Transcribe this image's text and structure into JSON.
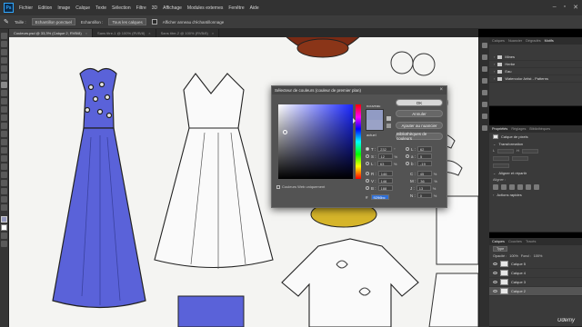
{
  "menubar": {
    "logo": "Ps",
    "items": [
      "Fichier",
      "Edition",
      "Image",
      "Calque",
      "Texte",
      "Sélection",
      "Filtre",
      "3D",
      "Affichage",
      "Modules externes",
      "Fenêtre",
      "Aide"
    ]
  },
  "options": {
    "sample_label": "Taille :",
    "sample_value": "Echantillon ponctuel",
    "layer_label": "Echantillon :",
    "layer_value": "Tous les calques",
    "ring_label": "Afficher anneau d'échantillonnage"
  },
  "tabs": [
    {
      "label": "Couleurs.psd @ 33,3% (Calque 2, RVB/8)",
      "active": true
    },
    {
      "label": "Sans titre-1 @ 100% (RVB/8)",
      "active": false
    },
    {
      "label": "Sans titre-2 @ 100% (RVB/8)",
      "active": false
    }
  ],
  "dialog": {
    "title": "Sélecteur de couleurs (couleur de premier plan)",
    "new_label": "nouveau",
    "current_label": "actuel",
    "buttons": {
      "ok": "OK",
      "cancel": "Annuler",
      "add_swatch": "Ajouter au nuancier",
      "libraries": "Bibliothèques de couleurs"
    },
    "hsb": [
      {
        "label": "T :",
        "value": "232",
        "unit": "°"
      },
      {
        "label": "S :",
        "value": "12",
        "unit": "%"
      },
      {
        "label": "L :",
        "value": "63",
        "unit": "%"
      }
    ],
    "rgb": [
      {
        "label": "R :",
        "value": "146",
        "unit": ""
      },
      {
        "label": "V :",
        "value": "146",
        "unit": ""
      },
      {
        "label": "B :",
        "value": "188",
        "unit": ""
      }
    ],
    "lab": [
      {
        "label": "L :",
        "value": "62",
        "unit": ""
      },
      {
        "label": "a :",
        "value": "5",
        "unit": ""
      },
      {
        "label": "b :",
        "value": "-19",
        "unit": ""
      }
    ],
    "cmyk": [
      {
        "label": "C :",
        "value": "45",
        "unit": "%"
      },
      {
        "label": "M :",
        "value": "36",
        "unit": "%"
      },
      {
        "label": "J :",
        "value": "13",
        "unit": "%"
      },
      {
        "label": "N :",
        "value": "0",
        "unit": "%"
      }
    ],
    "web_only": "Couleurs Web uniquement",
    "hex_label": "#",
    "hex_value": "9296bc",
    "new_color": "#919bc4",
    "current_color": "#9aa2c6"
  },
  "right_panel": {
    "top_tabs": [
      "Calques",
      "Nuancier",
      "Dégradés",
      "Motifs"
    ],
    "top_active": 3,
    "folders": [
      "Mines",
      "Herbe",
      "Eau",
      "Watercolor Artist - Patterns"
    ],
    "prop_tabs": [
      "Propriétés",
      "Réglages",
      "Bibliothèques"
    ],
    "prop_doc": "Calque de pixels",
    "transform_label": "Transformation",
    "w_label": "L",
    "h_label": "H",
    "align_label": "Aligner et répartir",
    "align_sub": "Aligner :",
    "quick_label": "Actions rapides",
    "layer_tabs": [
      "Calques",
      "Couches",
      "Tracés"
    ],
    "layer_filter": "Type",
    "opacity_label": "Opacité :",
    "opacity_value": "100%",
    "fill_label": "Fond :",
    "fill_value": "100%",
    "layers": [
      "Calque 5",
      "Calque 4",
      "Calque 3",
      "Calque 2"
    ]
  },
  "watermark": "Udemy"
}
